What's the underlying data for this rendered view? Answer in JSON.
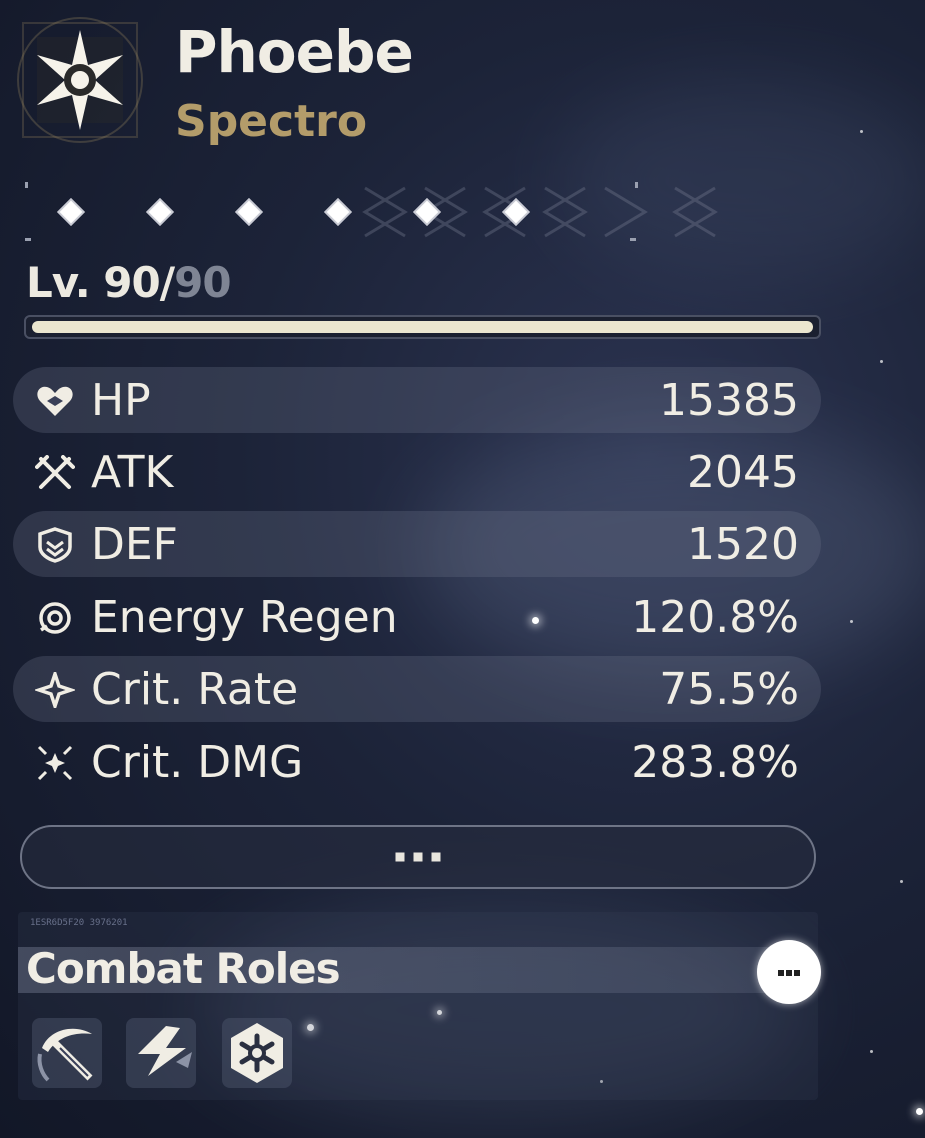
{
  "character": {
    "name": "Phoebe",
    "element": "Spectro",
    "element_color": "#b39c6a",
    "emblem_icon": "spectro-emblem-icon"
  },
  "sequence": {
    "unlocked": 6,
    "total": 6,
    "node_icon": "diamond-icon"
  },
  "level": {
    "prefix": "Lv. ",
    "current": "90",
    "separator": "/",
    "max": "90",
    "progress": 1.0
  },
  "stats": [
    {
      "icon": "heart-icon",
      "label": "HP",
      "value": "15385"
    },
    {
      "icon": "crossed-swords-icon",
      "label": "ATK",
      "value": "2045"
    },
    {
      "icon": "shield-icon",
      "label": "DEF",
      "value": "1520"
    },
    {
      "icon": "energy-regen-icon",
      "label": "Energy Regen",
      "value": "120.8%"
    },
    {
      "icon": "crit-rate-icon",
      "label": "Crit. Rate",
      "value": "75.5%"
    },
    {
      "icon": "crit-dmg-icon",
      "label": "Crit. DMG",
      "value": "283.8%"
    }
  ],
  "more_button": {
    "icon": "ellipsis-icon"
  },
  "combat_roles": {
    "serial": "1ESR6D5F20 3976201",
    "title": "Combat Roles",
    "more_icon": "ellipsis-icon",
    "roles": [
      {
        "icon": "scythe-blade-icon"
      },
      {
        "icon": "lightning-strike-icon"
      },
      {
        "icon": "spectro-burst-icon"
      }
    ]
  }
}
